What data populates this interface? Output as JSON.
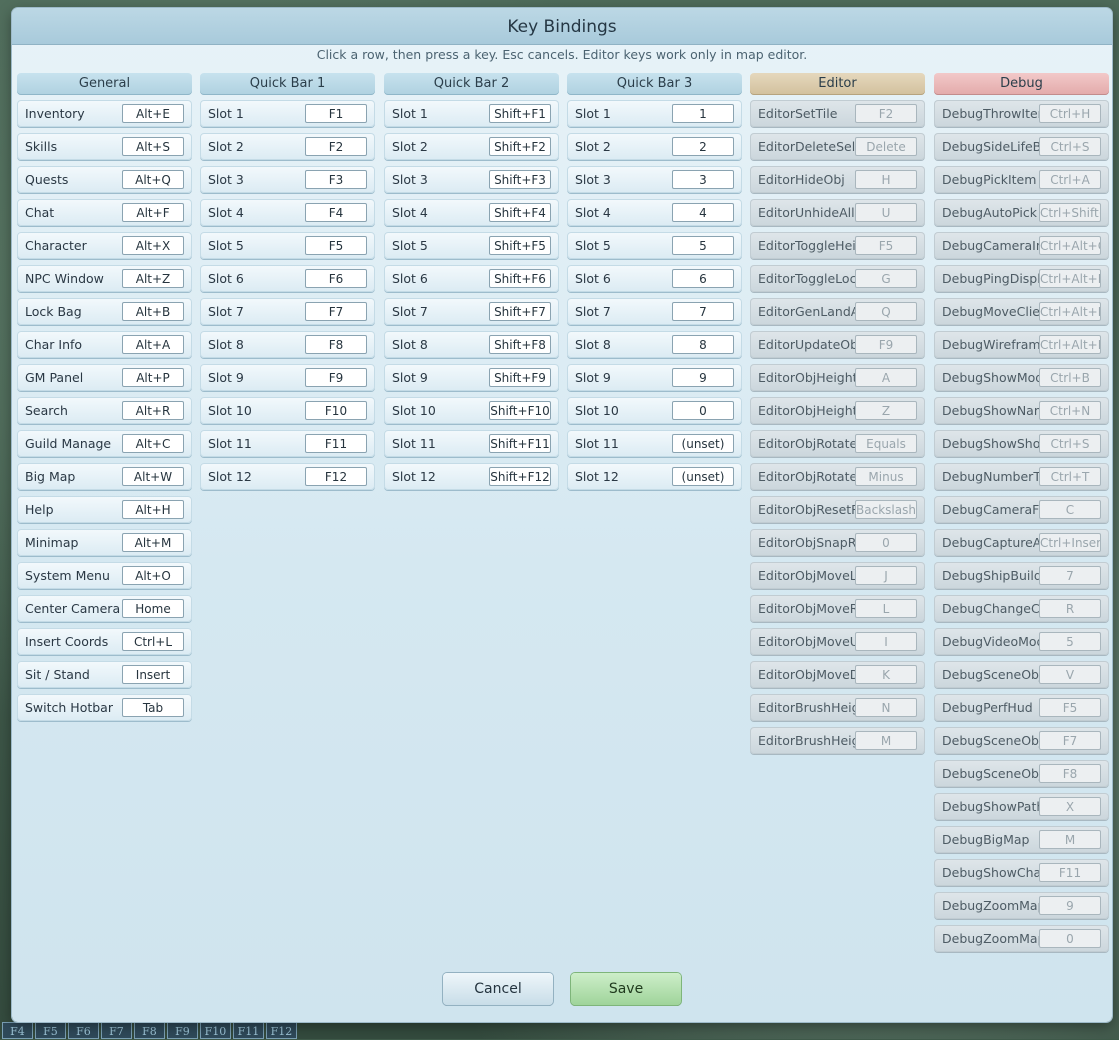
{
  "dialog": {
    "title": "Key Bindings",
    "subtitle": "Click a row, then press a key. Esc cancels. Editor keys work only in map editor.",
    "cancel_label": "Cancel",
    "save_label": "Save"
  },
  "bottom_bar": [
    "F4",
    "F5",
    "F6",
    "F7",
    "F8",
    "F9",
    "F10",
    "F11",
    "F12"
  ],
  "columns": [
    {
      "title": "General",
      "rows": [
        {
          "label": "Inventory",
          "key": "Alt+E"
        },
        {
          "label": "Skills",
          "key": "Alt+S"
        },
        {
          "label": "Quests",
          "key": "Alt+Q"
        },
        {
          "label": "Chat",
          "key": "Alt+F"
        },
        {
          "label": "Character",
          "key": "Alt+X"
        },
        {
          "label": "NPC Window",
          "key": "Alt+Z"
        },
        {
          "label": "Lock Bag",
          "key": "Alt+B"
        },
        {
          "label": "Char Info",
          "key": "Alt+A"
        },
        {
          "label": "GM Panel",
          "key": "Alt+P"
        },
        {
          "label": "Search",
          "key": "Alt+R"
        },
        {
          "label": "Guild Manage",
          "key": "Alt+C"
        },
        {
          "label": "Big Map",
          "key": "Alt+W"
        },
        {
          "label": "Help",
          "key": "Alt+H"
        },
        {
          "label": "Minimap",
          "key": "Alt+M"
        },
        {
          "label": "System Menu",
          "key": "Alt+O"
        },
        {
          "label": "Center Camera",
          "key": "Home"
        },
        {
          "label": "Insert Coords",
          "key": "Ctrl+L"
        },
        {
          "label": "Sit / Stand",
          "key": "Insert"
        },
        {
          "label": "Switch Hotbar",
          "key": "Tab"
        }
      ]
    },
    {
      "title": "Quick Bar 1",
      "rows": [
        {
          "label": "Slot 1",
          "key": "F1"
        },
        {
          "label": "Slot 2",
          "key": "F2"
        },
        {
          "label": "Slot 3",
          "key": "F3"
        },
        {
          "label": "Slot 4",
          "key": "F4"
        },
        {
          "label": "Slot 5",
          "key": "F5"
        },
        {
          "label": "Slot 6",
          "key": "F6"
        },
        {
          "label": "Slot 7",
          "key": "F7"
        },
        {
          "label": "Slot 8",
          "key": "F8"
        },
        {
          "label": "Slot 9",
          "key": "F9"
        },
        {
          "label": "Slot 10",
          "key": "F10"
        },
        {
          "label": "Slot 11",
          "key": "F11"
        },
        {
          "label": "Slot 12",
          "key": "F12"
        }
      ]
    },
    {
      "title": "Quick Bar 2",
      "rows": [
        {
          "label": "Slot 1",
          "key": "Shift+F1"
        },
        {
          "label": "Slot 2",
          "key": "Shift+F2"
        },
        {
          "label": "Slot 3",
          "key": "Shift+F3"
        },
        {
          "label": "Slot 4",
          "key": "Shift+F4"
        },
        {
          "label": "Slot 5",
          "key": "Shift+F5"
        },
        {
          "label": "Slot 6",
          "key": "Shift+F6"
        },
        {
          "label": "Slot 7",
          "key": "Shift+F7"
        },
        {
          "label": "Slot 8",
          "key": "Shift+F8"
        },
        {
          "label": "Slot 9",
          "key": "Shift+F9"
        },
        {
          "label": "Slot 10",
          "key": "Shift+F10"
        },
        {
          "label": "Slot 11",
          "key": "Shift+F11"
        },
        {
          "label": "Slot 12",
          "key": "Shift+F12"
        }
      ]
    },
    {
      "title": "Quick Bar 3",
      "rows": [
        {
          "label": "Slot 1",
          "key": "1"
        },
        {
          "label": "Slot 2",
          "key": "2"
        },
        {
          "label": "Slot 3",
          "key": "3"
        },
        {
          "label": "Slot 4",
          "key": "4"
        },
        {
          "label": "Slot 5",
          "key": "5"
        },
        {
          "label": "Slot 6",
          "key": "6"
        },
        {
          "label": "Slot 7",
          "key": "7"
        },
        {
          "label": "Slot 8",
          "key": "8"
        },
        {
          "label": "Slot 9",
          "key": "9"
        },
        {
          "label": "Slot 10",
          "key": "0"
        },
        {
          "label": "Slot 11",
          "key": "(unset)"
        },
        {
          "label": "Slot 12",
          "key": "(unset)"
        }
      ]
    },
    {
      "title": "Editor",
      "style": "editor",
      "disabled": true,
      "rows": [
        {
          "label": "EditorSetTile",
          "key": "F2"
        },
        {
          "label": "EditorDeleteSelec",
          "key": "Delete"
        },
        {
          "label": "EditorHideObj",
          "key": "H"
        },
        {
          "label": "EditorUnhideAll",
          "key": "U"
        },
        {
          "label": "EditorToggleHeig",
          "key": "F5"
        },
        {
          "label": "EditorToggleLock",
          "key": "G"
        },
        {
          "label": "EditorGenLandAt",
          "key": "Q"
        },
        {
          "label": "EditorUpdateObj",
          "key": "F9"
        },
        {
          "label": "EditorObjHeightU",
          "key": "A"
        },
        {
          "label": "EditorObjHeightD",
          "key": "Z"
        },
        {
          "label": "EditorObjRotateC",
          "key": "Equals"
        },
        {
          "label": "EditorObjRotateC",
          "key": "Minus"
        },
        {
          "label": "EditorObjResetRo",
          "key": "Backslash"
        },
        {
          "label": "EditorObjSnapRot",
          "key": "0"
        },
        {
          "label": "EditorObjMoveLe",
          "key": "J"
        },
        {
          "label": "EditorObjMoveRig",
          "key": "L"
        },
        {
          "label": "EditorObjMoveUp",
          "key": "I"
        },
        {
          "label": "EditorObjMoveDo",
          "key": "K"
        },
        {
          "label": "EditorBrushHeigh",
          "key": "N"
        },
        {
          "label": "EditorBrushHeigh",
          "key": "M"
        }
      ]
    },
    {
      "title": "Debug",
      "style": "debug",
      "disabled": true,
      "rows": [
        {
          "label": "DebugThrowItem",
          "key": "Ctrl+H"
        },
        {
          "label": "DebugSideLifeBa",
          "key": "Ctrl+S"
        },
        {
          "label": "DebugPickItem",
          "key": "Ctrl+A"
        },
        {
          "label": "DebugAutoPick",
          "key": "Ctrl+Shift+A"
        },
        {
          "label": "DebugCameraInf",
          "key": "Ctrl+Alt+C"
        },
        {
          "label": "DebugPingDispla",
          "key": "Ctrl+Alt+K"
        },
        {
          "label": "DebugMoveClien",
          "key": "Ctrl+Alt+M"
        },
        {
          "label": "DebugWireframe",
          "key": "Ctrl+Alt+F"
        },
        {
          "label": "DebugShowMode",
          "key": "Ctrl+B"
        },
        {
          "label": "DebugShowNam",
          "key": "Ctrl+N"
        },
        {
          "label": "DebugShowShop",
          "key": "Ctrl+S"
        },
        {
          "label": "DebugNumberTo",
          "key": "Ctrl+T"
        },
        {
          "label": "DebugCameraFo",
          "key": "C"
        },
        {
          "label": "DebugCaptureAv",
          "key": "Ctrl+Insert"
        },
        {
          "label": "DebugShipBuilde",
          "key": "7"
        },
        {
          "label": "DebugChangeCh",
          "key": "R"
        },
        {
          "label": "DebugVideoMode",
          "key": "5"
        },
        {
          "label": "DebugSceneObjC",
          "key": "V"
        },
        {
          "label": "DebugPerfHud",
          "key": "F5"
        },
        {
          "label": "DebugSceneObjT",
          "key": "F7"
        },
        {
          "label": "DebugSceneObj",
          "key": "F8"
        },
        {
          "label": "DebugShowPath",
          "key": "X"
        },
        {
          "label": "DebugBigMap",
          "key": "M"
        },
        {
          "label": "DebugShowChain",
          "key": "F11"
        },
        {
          "label": "DebugZoomMap",
          "key": "9"
        },
        {
          "label": "DebugZoomMap",
          "key": "0"
        }
      ]
    }
  ]
}
